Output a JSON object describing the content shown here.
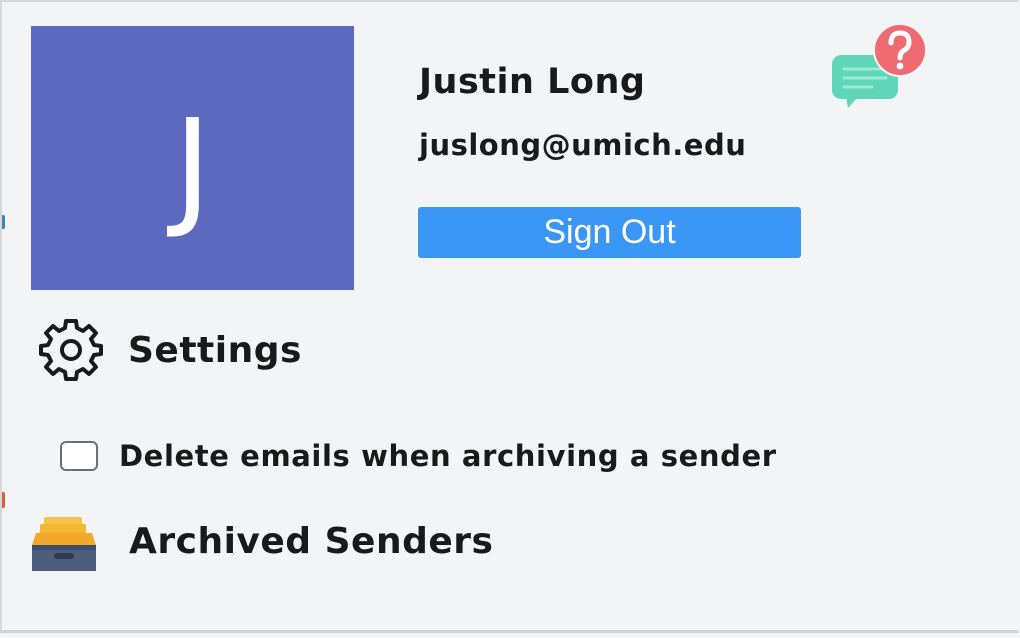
{
  "user": {
    "avatar_initial": "J",
    "avatar_color": "#5b6abf",
    "name": "Justin Long",
    "email": "juslong@umich.edu"
  },
  "actions": {
    "sign_out_label": "Sign Out",
    "sign_out_color": "#3a97f5"
  },
  "help": {
    "icon": "help-chat-icon",
    "bubble_color": "#5fd6b8",
    "badge_color": "#f06a72"
  },
  "settings": {
    "icon": "gear-icon",
    "label": "Settings",
    "delete_on_archive": {
      "label": "Delete emails when archiving a sender",
      "checked": false
    }
  },
  "archived_senders": {
    "icon": "archive-box-icon",
    "label": "Archived Senders"
  }
}
